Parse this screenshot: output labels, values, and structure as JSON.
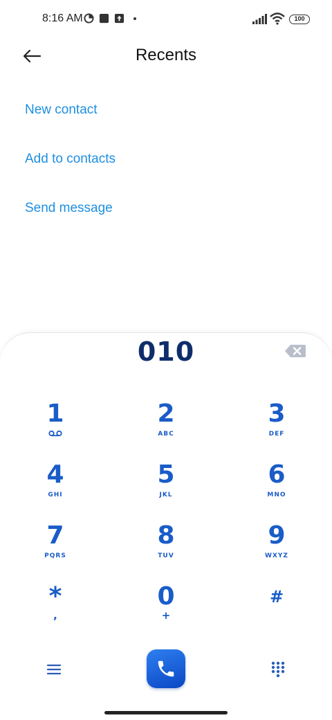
{
  "status_bar": {
    "time": "8:16 AM",
    "battery": "100",
    "icons": [
      "data-saver-icon",
      "square-icon",
      "upload-icon",
      "signal-icon",
      "wifi-icon",
      "battery-icon"
    ]
  },
  "header": {
    "title": "Recents",
    "back_icon": "arrow-left-icon"
  },
  "actions": {
    "new_contact": "New contact",
    "add_to_contacts": "Add to contacts",
    "send_message": "Send message"
  },
  "dialer": {
    "number": "010",
    "backspace_icon": "backspace-icon",
    "keys": [
      {
        "digit": "1",
        "letters": "",
        "icon": "voicemail-icon"
      },
      {
        "digit": "2",
        "letters": "ABC"
      },
      {
        "digit": "3",
        "letters": "DEF"
      },
      {
        "digit": "4",
        "letters": "GHI"
      },
      {
        "digit": "5",
        "letters": "JKL"
      },
      {
        "digit": "6",
        "letters": "MNO"
      },
      {
        "digit": "7",
        "letters": "PQRS"
      },
      {
        "digit": "8",
        "letters": "TUV"
      },
      {
        "digit": "9",
        "letters": "WXYZ"
      },
      {
        "digit": "*",
        "letters": ","
      },
      {
        "digit": "0",
        "letters": "+"
      },
      {
        "digit": "#",
        "letters": ""
      }
    ],
    "bottom": {
      "menu_icon": "menu-icon",
      "call_icon": "phone-icon",
      "keypad_icon": "dialpad-icon"
    }
  },
  "colors": {
    "accent": "#1e8fe0",
    "digit": "#1a5cc8",
    "number": "#0f2d6b",
    "call_start": "#2f7ff0",
    "call_end": "#0a47c4"
  }
}
